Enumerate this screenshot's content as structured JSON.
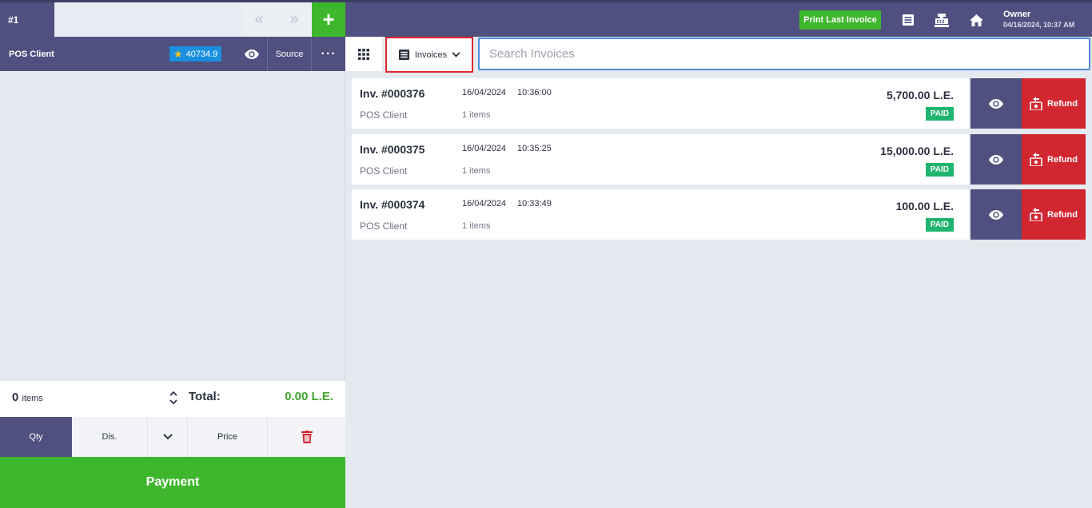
{
  "left": {
    "tab_label": "#1",
    "prev_icon": "«",
    "next_icon": "»",
    "add_icon": "+",
    "client_name": "POS Client",
    "points": "40734.9",
    "source_label": "Source",
    "more_icon": "···",
    "items_count": "0",
    "items_label": "items",
    "total_label": "Total:",
    "total_value": "0.00 L.E.",
    "keys": {
      "qty": "Qty",
      "dis": "Dis.",
      "price": "Price"
    },
    "payment_label": "Payment"
  },
  "header": {
    "print_last_label": "Print Last Invoice",
    "owner_name": "Owner",
    "owner_datetime": "04/16/2024, 10:37 AM"
  },
  "toolbar": {
    "invoices_label": "Invoices",
    "search_placeholder": "Search Invoices"
  },
  "invoices": [
    {
      "number": "Inv. #000376",
      "date": "16/04/2024",
      "time": "10:36:00",
      "client": "POS Client",
      "items": "1 items",
      "amount": "5,700.00 L.E.",
      "status": "PAID",
      "refund_label": "Refund"
    },
    {
      "number": "Inv. #000375",
      "date": "16/04/2024",
      "time": "10:35:25",
      "client": "POS Client",
      "items": "1 items",
      "amount": "15,000.00 L.E.",
      "status": "PAID",
      "refund_label": "Refund"
    },
    {
      "number": "Inv. #000374",
      "date": "16/04/2024",
      "time": "10:33:49",
      "client": "POS Client",
      "items": "1 items",
      "amount": "100.00 L.E.",
      "status": "PAID",
      "refund_label": "Refund"
    }
  ],
  "colors": {
    "primary": "#4f507f",
    "accent": "#3fb72d",
    "danger": "#d22630",
    "paid": "#1fb56e",
    "points": "#1a8fe0"
  }
}
